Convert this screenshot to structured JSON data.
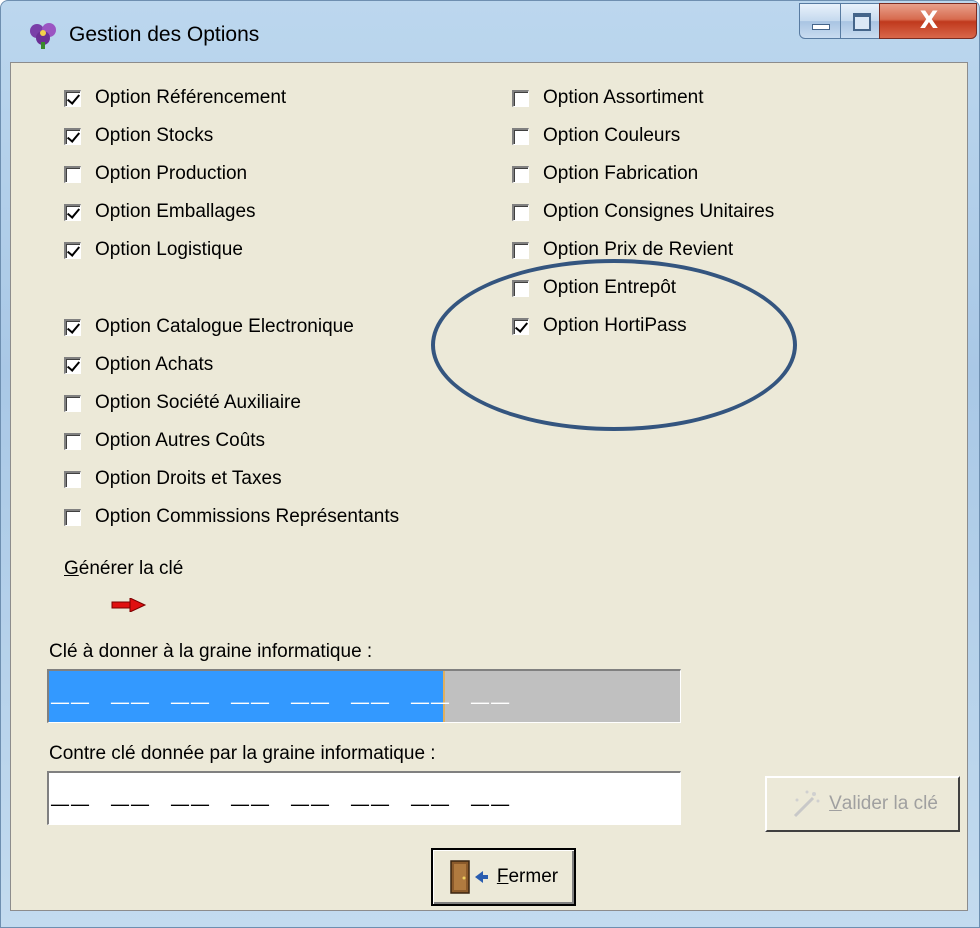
{
  "window": {
    "title": "Gestion des Options",
    "controls": {
      "minimize": "minimize",
      "maximize": "maximize",
      "close": "X"
    }
  },
  "options_left": [
    {
      "label": "Option Référencement",
      "checked": true
    },
    {
      "label": "Option Stocks",
      "checked": true
    },
    {
      "label": "Option Production",
      "checked": false
    },
    {
      "label": "Option Emballages",
      "checked": true
    },
    {
      "label": "Option Logistique",
      "checked": true
    },
    {
      "label": "Option Catalogue Electronique",
      "checked": true
    },
    {
      "label": "Option Achats",
      "checked": true
    },
    {
      "label": "Option Société Auxiliaire",
      "checked": false
    },
    {
      "label": "Option Autres Coûts",
      "checked": false
    },
    {
      "label": "Option Droits et Taxes",
      "checked": false
    },
    {
      "label": "Option Commissions Représentants",
      "checked": false
    }
  ],
  "options_right": [
    {
      "label": "Option Assortiment",
      "checked": false
    },
    {
      "label": "Option Couleurs",
      "checked": false
    },
    {
      "label": "Option Fabrication",
      "checked": false
    },
    {
      "label": "Option Consignes Unitaires",
      "checked": false
    },
    {
      "label": "Option Prix de Revient",
      "checked": false
    },
    {
      "label": "Option Entrepôt",
      "checked": false
    },
    {
      "label": "Option HortiPass",
      "checked": true
    }
  ],
  "generate": {
    "label_first": "G",
    "label_rest": "énérer la clé",
    "icon": "red-arrow-icon"
  },
  "key": {
    "label": "Clé à donner à la graine informatique :",
    "value": "__ __ __ __ __ __ __ __"
  },
  "counter_key": {
    "label": "Contre clé donnée par la graine informatique :",
    "value": "__ __ __ __ __ __ __ __"
  },
  "buttons": {
    "validate_first": "V",
    "validate_rest": "alider la clé",
    "close_first": "F",
    "close_rest": "ermer"
  },
  "colors": {
    "selection": "#3399ff",
    "annotation_circle": "#34557f",
    "arrow": "#e01010"
  }
}
